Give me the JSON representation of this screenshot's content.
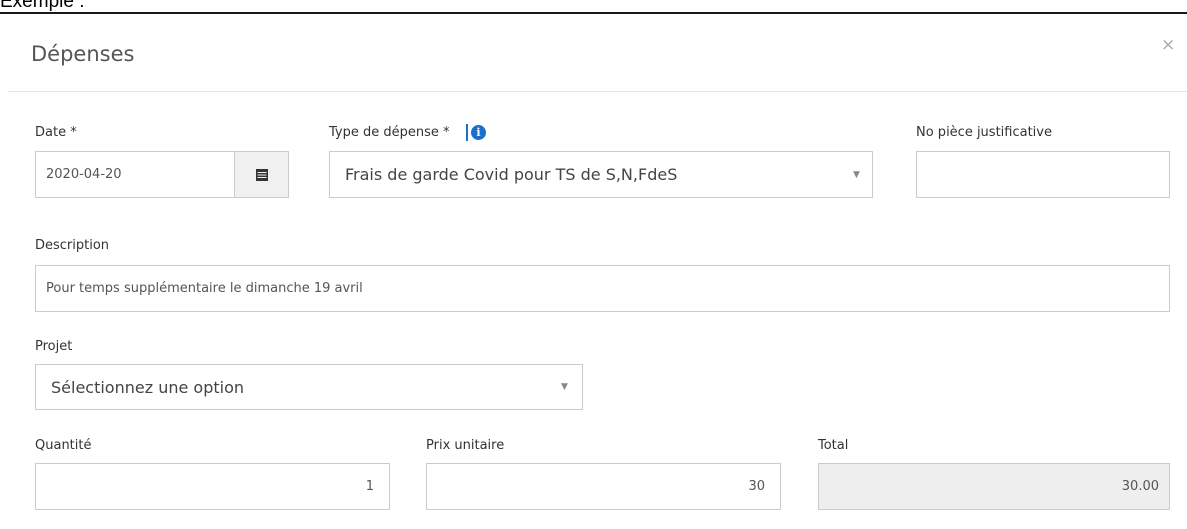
{
  "caption": "Exemple :",
  "dialog": {
    "title": "Dépenses",
    "close_glyph": "×"
  },
  "form": {
    "date": {
      "label": "Date *",
      "value": "2020-04-20",
      "button_icon": "calendar-icon"
    },
    "type": {
      "label": "Type de dépense *",
      "info_icon": "info-icon",
      "value": "Frais de garde Covid pour TS de S,N,FdeS"
    },
    "piece": {
      "label": "No pièce justificative",
      "value": ""
    },
    "description": {
      "label": "Description",
      "value": "Pour temps supplémentaire le dimanche 19 avril"
    },
    "projet": {
      "label": "Projet",
      "value": "Sélectionnez une option"
    },
    "quantite": {
      "label": "Quantité",
      "value": "1"
    },
    "prix": {
      "label": "Prix unitaire",
      "value": "30"
    },
    "total": {
      "label": "Total",
      "value": "30.00"
    }
  }
}
